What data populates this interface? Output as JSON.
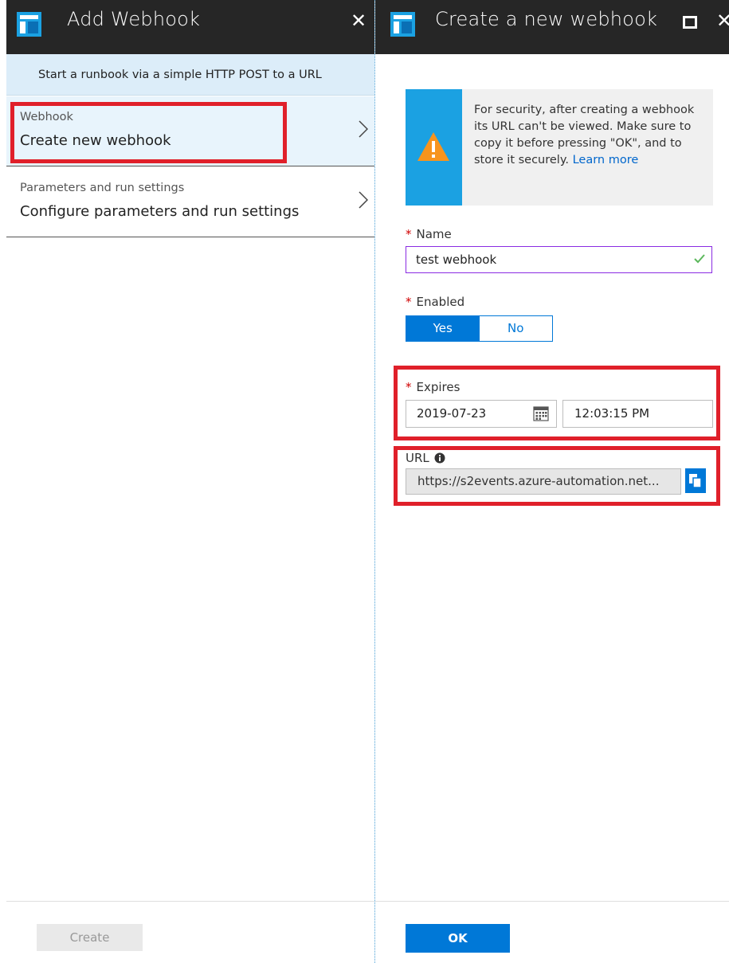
{
  "left_blade": {
    "title": "Add Webhook",
    "close_glyph": "✕",
    "description": "Start a runbook via a simple HTTP POST to a URL",
    "items": [
      {
        "sub": "Webhook",
        "main": "Create new webhook"
      },
      {
        "sub": "Parameters and run settings",
        "main": "Configure parameters and run settings"
      }
    ],
    "create_label": "Create"
  },
  "right_blade": {
    "title": "Create a new webhook",
    "maximize_glyph": "□",
    "close_glyph": "✕",
    "warning": {
      "text": "For security, after creating a webhook its URL can't be viewed. Make sure to copy it before pressing \"OK\", and to store it securely. ",
      "link": "Learn more",
      "icon": "warning-triangle-icon"
    },
    "name": {
      "required": "*",
      "label": "Name",
      "value": "test webhook"
    },
    "enabled": {
      "required": "*",
      "label": "Enabled",
      "yes": "Yes",
      "no": "No",
      "selected": "Yes"
    },
    "expires": {
      "required": "*",
      "label": "Expires",
      "date": "2019-07-23",
      "time": "12:03:15 PM"
    },
    "url": {
      "label": "URL",
      "value": "https://s2events.azure-automation.net..."
    },
    "ok_label": "OK"
  },
  "colors": {
    "accent": "#0078d7",
    "header_bg": "#262626",
    "highlight": "#e0202a",
    "warning_strip": "#1ba1e2",
    "warning_icon": "#f7941d"
  }
}
